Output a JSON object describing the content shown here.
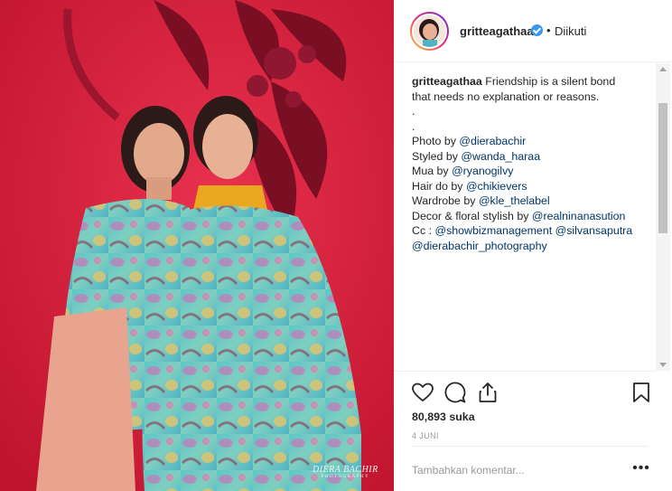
{
  "post": {
    "username": "gritteagathaa",
    "follow_state": "Diikuti",
    "dot": "•",
    "watermark": "DIERA BACHIR",
    "watermark_sub": "PHOTOGRAPHY"
  },
  "caption": {
    "username": "gritteagathaa",
    "lines": [
      "Friendship is a silent bond",
      "that needs no explanation or reasons.",
      ".",
      ".",
      "Photo by",
      "Styled by",
      "Mua by",
      "Hair do by",
      "Wardrobe by",
      "Decor & floral stylish by",
      "Cc :",
      "@dierabachir_photography"
    ],
    "mentions": [
      "@dierabachir",
      "@wanda_haraa",
      "@ryanogilvy",
      "@chikievers",
      "@kle_thelabel",
      "@realninanasution",
      "@showbizmanagement",
      "@silvansaputra"
    ]
  },
  "stats": {
    "likes": "80,893 suka",
    "date": "4 JUNI"
  },
  "comment": {
    "placeholder": "Tambahkan komentar...",
    "more": "•••"
  },
  "icons": {
    "like": "heart-icon",
    "comment": "comment-icon",
    "share": "share-icon",
    "save": "bookmark-icon",
    "verified": "verified-badge-icon"
  },
  "colors": {
    "verified": "#3897f0",
    "mention": "#003569",
    "photo_background": "#d41f3c"
  }
}
